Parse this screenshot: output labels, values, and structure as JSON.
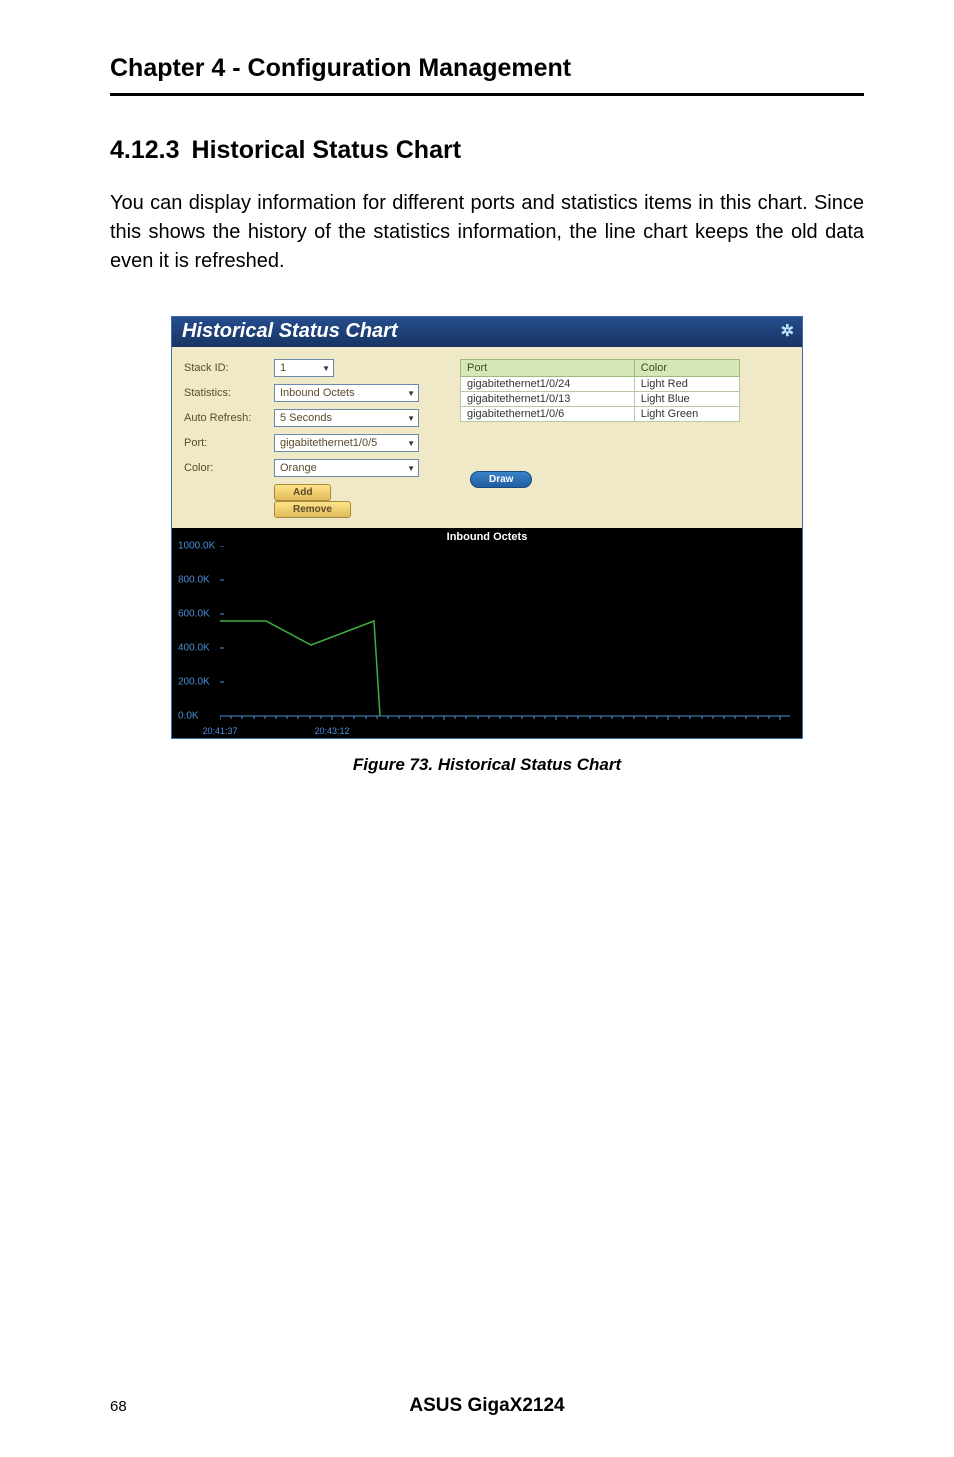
{
  "chapter_header": "Chapter 4 - Configuration Management",
  "section_number": "4.12.3",
  "section_title": "Historical Status Chart",
  "body_text": "You can display information for different ports and statistics items in this chart. Since this shows the history of the statistics information, the line chart keeps the old data even it is refreshed.",
  "app": {
    "title": "Historical Status Chart",
    "fields": {
      "stack_id_label": "Stack ID:",
      "stack_id_value": "1",
      "statistics_label": "Statistics:",
      "statistics_value": "Inbound Octets",
      "auto_refresh_label": "Auto Refresh:",
      "auto_refresh_value": "5 Seconds",
      "port_label": "Port:",
      "port_value": "gigabitethernet1/0/5",
      "color_label": "Color:",
      "color_value": "Orange"
    },
    "buttons": {
      "add": "Add",
      "remove": "Remove",
      "draw": "Draw"
    },
    "table": {
      "headers": {
        "port": "Port",
        "color": "Color"
      },
      "rows": [
        {
          "port": "gigabitethernet1/0/24",
          "color": "Light Red"
        },
        {
          "port": "gigabitethernet1/0/13",
          "color": "Light Blue"
        },
        {
          "port": "gigabitethernet1/0/6",
          "color": "Light Green"
        }
      ]
    },
    "chart_title": "Inbound Octets"
  },
  "chart_data": {
    "type": "line",
    "title": "Inbound Octets",
    "xlabel": "",
    "ylabel": "",
    "ylim": [
      0,
      1000
    ],
    "y_ticks": [
      "1000.0K",
      "800.0K",
      "600.0K",
      "400.0K",
      "200.0K",
      "0.0K"
    ],
    "x_ticks": [
      "20:41:37",
      "20:43:12"
    ],
    "series": [
      {
        "name": "gigabitethernet1/0/6",
        "color": "#3fae3f",
        "points": [
          {
            "x": 0.0,
            "y": 560
          },
          {
            "x": 0.08,
            "y": 560
          },
          {
            "x": 0.16,
            "y": 420
          },
          {
            "x": 0.27,
            "y": 560
          },
          {
            "x": 0.28,
            "y": 0
          }
        ]
      }
    ]
  },
  "figure_caption": "Figure 73. Historical Status Chart",
  "footer": {
    "page_number": "68",
    "product": "ASUS GigaX2124"
  }
}
